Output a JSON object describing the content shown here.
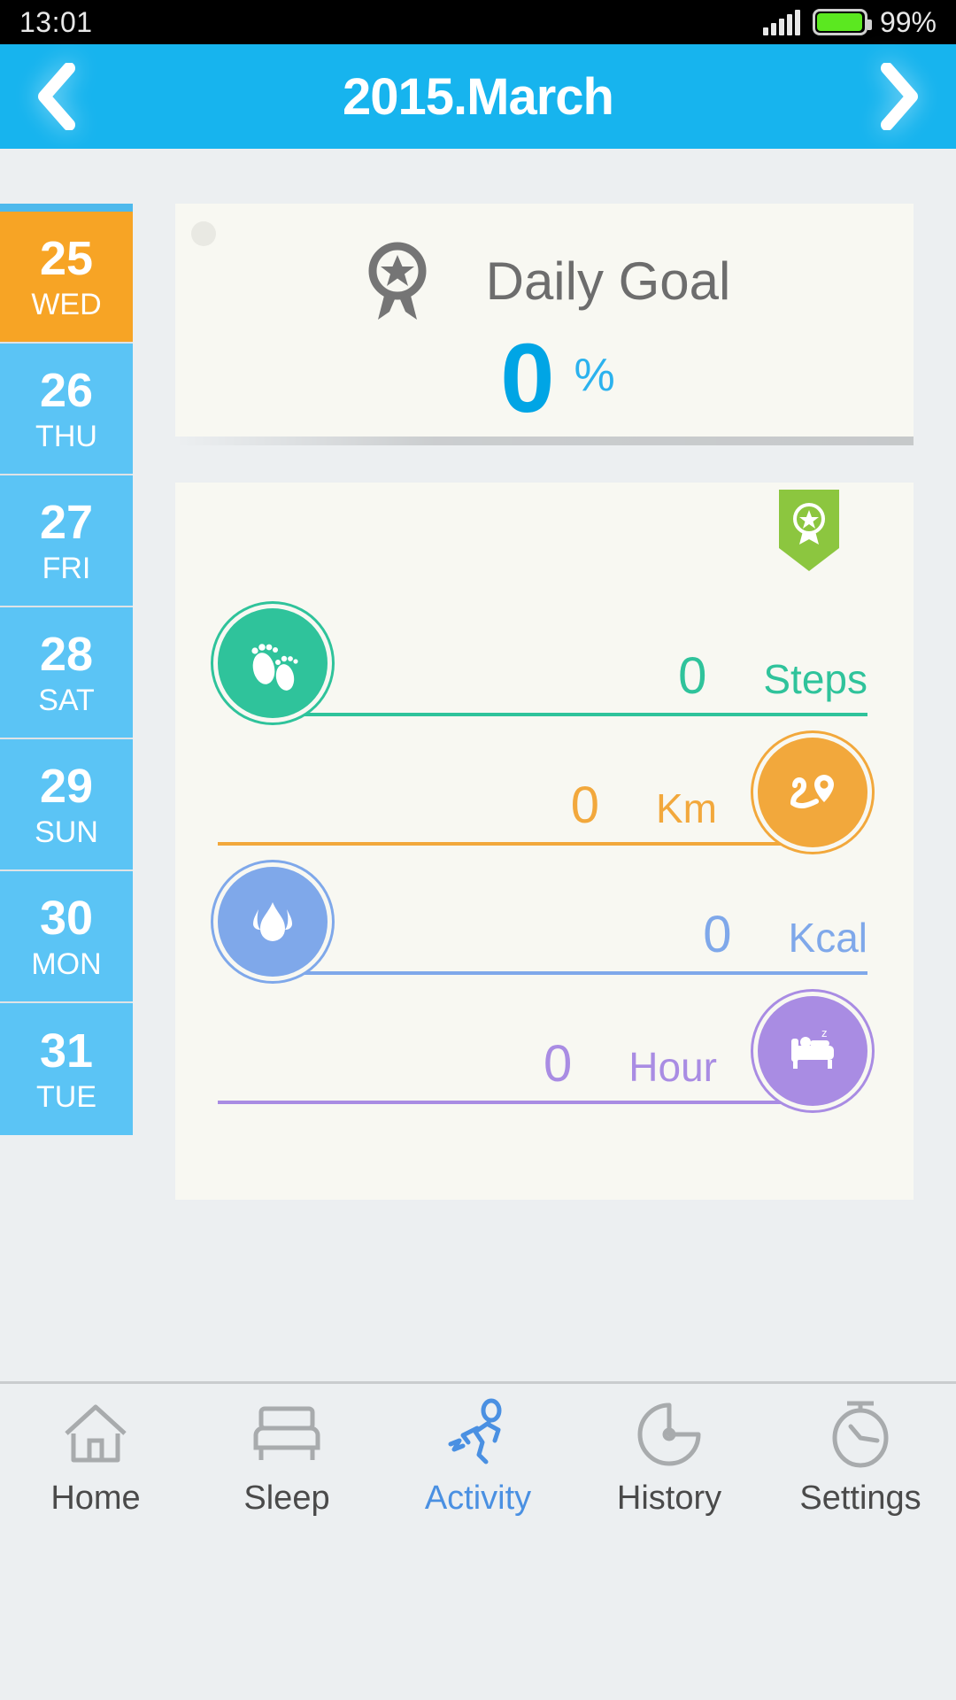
{
  "status_bar": {
    "time": "13:01",
    "battery_percent": "99%",
    "signal_icon": "signal-bars-icon",
    "battery_icon": "battery-icon"
  },
  "header": {
    "title": "2015.March",
    "prev_icon": "chevron-left-icon",
    "next_icon": "chevron-right-icon",
    "background_color": "#17B4EE"
  },
  "date_rail": {
    "selected_color": "#F7A425",
    "default_color": "#5BC4F5",
    "days": [
      {
        "num": "25",
        "name": "WED",
        "selected": true
      },
      {
        "num": "26",
        "name": "THU",
        "selected": false
      },
      {
        "num": "27",
        "name": "FRI",
        "selected": false
      },
      {
        "num": "28",
        "name": "SAT",
        "selected": false
      },
      {
        "num": "29",
        "name": "SUN",
        "selected": false
      },
      {
        "num": "30",
        "name": "MON",
        "selected": false
      },
      {
        "num": "31",
        "name": "TUE",
        "selected": false
      }
    ]
  },
  "daily_goal": {
    "title": "Daily Goal",
    "value": "0",
    "unit": "%",
    "medal_icon": "award-medal-icon",
    "value_color": "#00A5E5"
  },
  "metrics": {
    "badge_icon": "award-ribbon-badge-icon",
    "badge_color": "#8CC63F",
    "rows": [
      {
        "value": "0",
        "label": "Steps",
        "icon": "footprints-icon",
        "color": "#2FC39B",
        "icon_side": "left"
      },
      {
        "value": "0",
        "label": "Km",
        "icon": "route-map-pin-icon",
        "color": "#F2A83C",
        "icon_side": "right"
      },
      {
        "value": "0",
        "label": "Kcal",
        "icon": "flame-drop-icon",
        "color": "#7FA8EA",
        "icon_side": "left"
      },
      {
        "value": "0",
        "label": "Hour",
        "icon": "bed-sleep-icon",
        "color": "#A98CE3",
        "icon_side": "right"
      }
    ]
  },
  "tab_bar": {
    "active_color": "#4A90E2",
    "tabs": [
      {
        "label": "Home",
        "icon": "home-icon",
        "active": false
      },
      {
        "label": "Sleep",
        "icon": "bed-icon",
        "active": false
      },
      {
        "label": "Activity",
        "icon": "running-icon",
        "active": true
      },
      {
        "label": "History",
        "icon": "pie-clock-icon",
        "active": false
      },
      {
        "label": "Settings",
        "icon": "stopwatch-icon",
        "active": false
      }
    ]
  }
}
